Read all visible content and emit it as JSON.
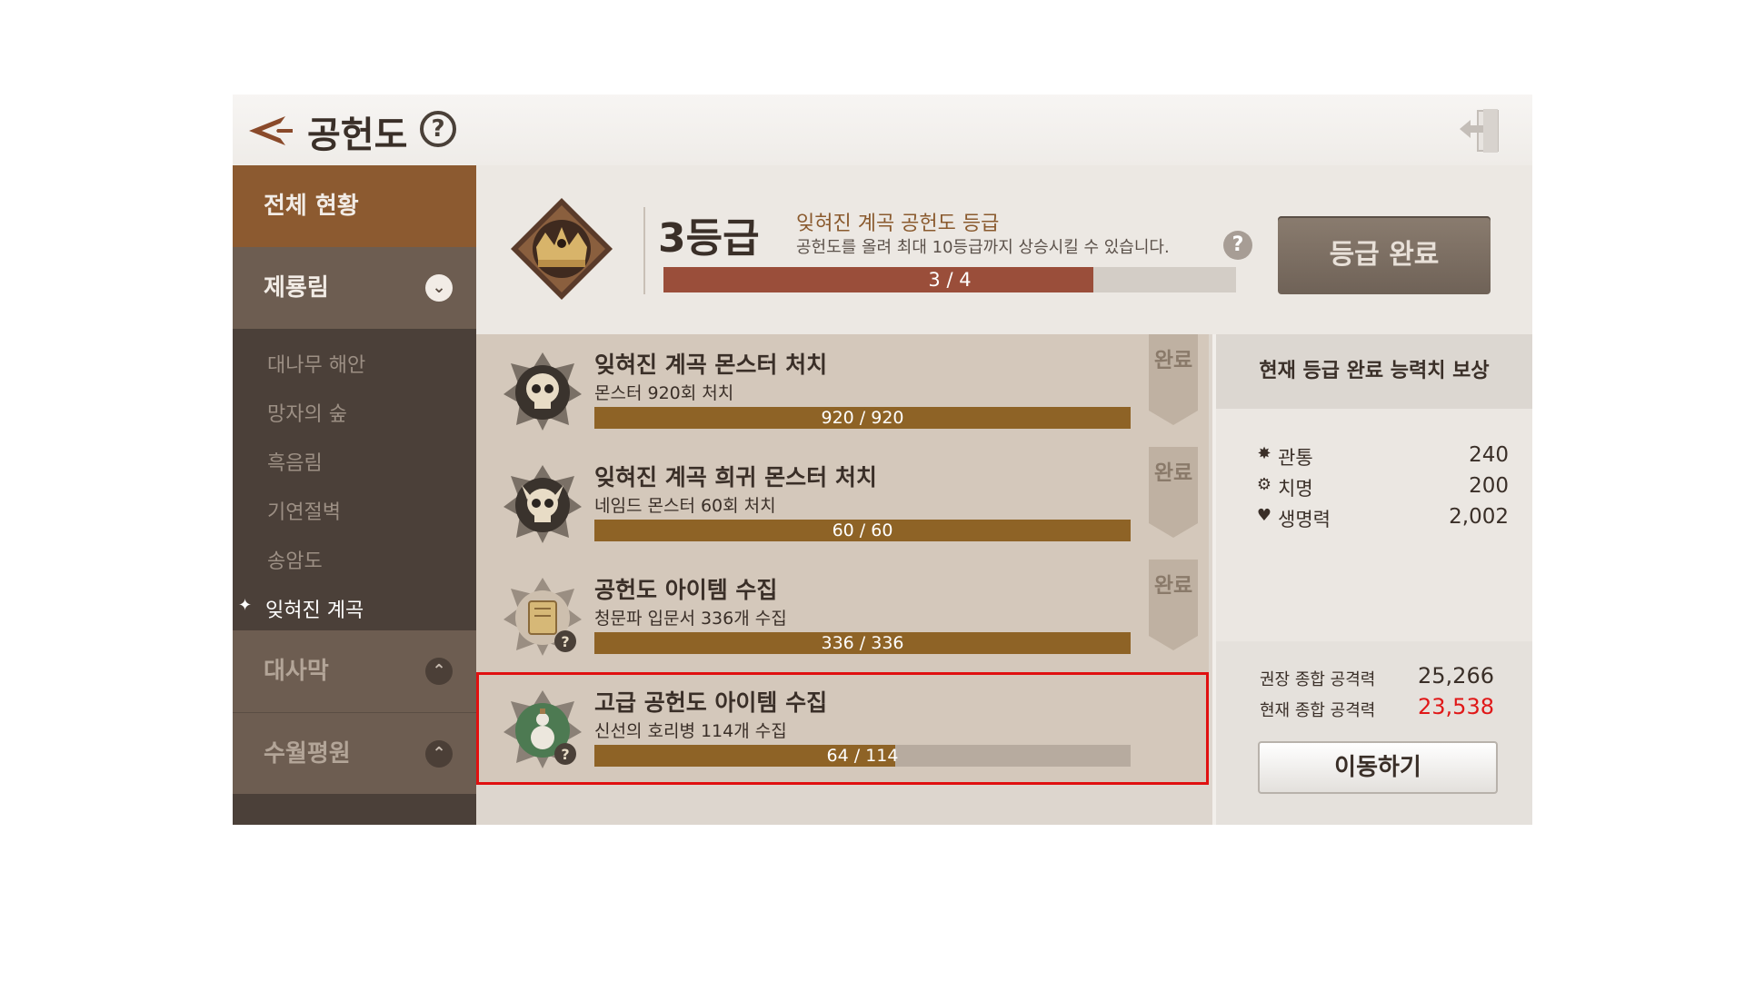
{
  "header": {
    "title": "공헌도",
    "help_symbol": "?"
  },
  "sidebar": {
    "overview_label": "전체 현황",
    "region_1": {
      "label": "제룡림",
      "expanded": true,
      "items": [
        "대나무 해안",
        "망자의 숲",
        "흑음림",
        "기연절벽",
        "송암도",
        "잊혀진 계곡"
      ],
      "current_item": "잊혀진 계곡"
    },
    "region_2": {
      "label": "대사막"
    },
    "region_3": {
      "label": "수월평원"
    }
  },
  "grade": {
    "level": "3등급",
    "name": "잊혀진 계곡 공헌도 등급",
    "description": "공헌도를 올려 최대 10등급까지 상승시킬 수 있습니다.",
    "help_symbol": "?",
    "progress_text": "3 / 4",
    "progress": 0.75,
    "complete_button": "등급 완료"
  },
  "quests": [
    {
      "title": "잊혀진 계곡 몬스터 처치",
      "desc": "몬스터 920회 처치",
      "progress_text": "920 / 920",
      "progress": 1.0,
      "done": true,
      "done_label": "완료",
      "icon": "skull-badge-icon"
    },
    {
      "title": "잊혀진 계곡 희귀 몬스터 처치",
      "desc": "네임드 몬스터 60회 처치",
      "progress_text": "60 / 60",
      "progress": 1.0,
      "done": true,
      "done_label": "완료",
      "icon": "horned-skull-badge-icon"
    },
    {
      "title": "공헌도 아이템 수집",
      "desc": "청문파 입문서 336개 수집",
      "progress_text": "336 / 336",
      "progress": 1.0,
      "done": true,
      "done_label": "완료",
      "icon": "scroll-badge-icon",
      "help_symbol": "?"
    },
    {
      "title": "고급 공헌도 아이템 수집",
      "desc": "신선의 호리병 114개 수집",
      "progress_text": "64 / 114",
      "progress": 0.561,
      "done": false,
      "icon": "gourd-badge-icon",
      "help_symbol": "?"
    }
  ],
  "reward": {
    "title": "현재 등급 완료 능력치 보상",
    "stats": [
      {
        "icon": "pierce-icon",
        "label": "관통",
        "value": "240"
      },
      {
        "icon": "gear-icon",
        "label": "치명",
        "value": "200"
      },
      {
        "icon": "heart-icon",
        "label": "생명력",
        "value": "2,002"
      }
    ],
    "recommended_label": "권장 종합 공격력",
    "recommended_value": "25,266",
    "current_label": "현재 종합 공격력",
    "current_value": "23,538",
    "move_button": "이동하기"
  },
  "colors": {
    "accent_brown": "#8c5a30",
    "progress_red": "#9a4e3a",
    "progress_gold": "#8e6326",
    "warning_red": "#e01818",
    "highlight": "#e01010"
  }
}
